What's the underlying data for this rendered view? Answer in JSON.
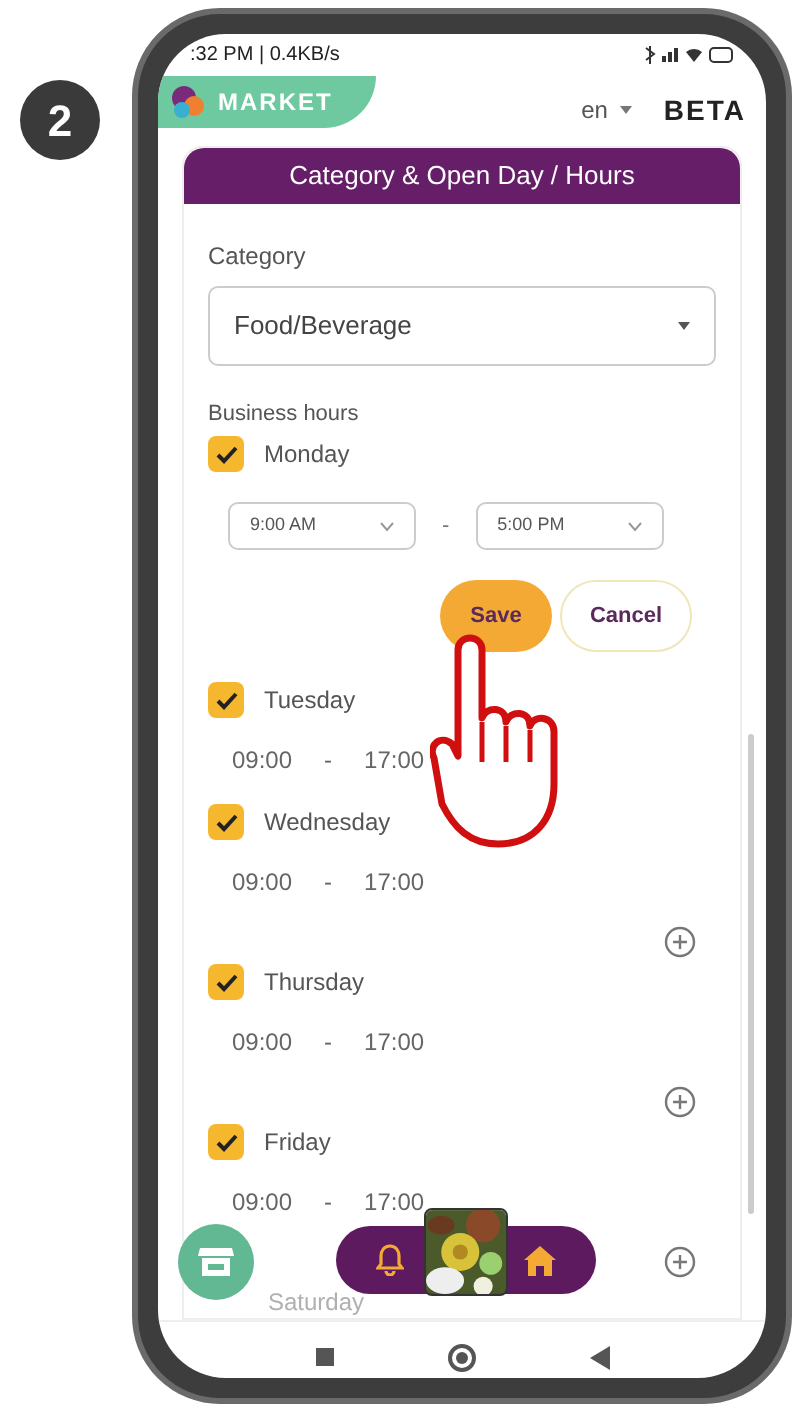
{
  "step": "2",
  "status_bar": {
    "text": ":32 PM | 0.4KB/s"
  },
  "header": {
    "logo": "MARKET",
    "language": "en",
    "badge": "BETA"
  },
  "panel": {
    "title": "Category & Open Day / Hours"
  },
  "category": {
    "label": "Category",
    "value": "Food/Beverage"
  },
  "business_hours": {
    "label": "Business hours"
  },
  "days": [
    {
      "kind": "editing",
      "name": "Monday",
      "checked": true,
      "start": "9:00 AM",
      "end": "5:00 PM",
      "separator": "-",
      "save": "Save",
      "cancel": "Cancel"
    },
    {
      "kind": "display",
      "name": "Tuesday",
      "checked": true,
      "start": "09:00",
      "end": "17:00",
      "separator": "-",
      "add": false
    },
    {
      "kind": "display",
      "name": "Wednesday",
      "checked": true,
      "start": "09:00",
      "end": "17:00",
      "separator": "-",
      "add": true
    },
    {
      "kind": "display",
      "name": "Thursday",
      "checked": true,
      "start": "09:00",
      "end": "17:00",
      "separator": "-",
      "add": true
    },
    {
      "kind": "display",
      "name": "Friday",
      "checked": true,
      "start": "09:00",
      "end": "17:00",
      "separator": "-",
      "add": true
    },
    {
      "kind": "faded",
      "name": "Saturday"
    }
  ]
}
